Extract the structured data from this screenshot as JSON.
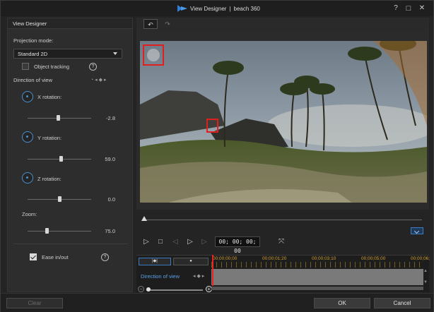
{
  "window": {
    "app_title": "View Designer",
    "separator": "|",
    "project_name": "beach 360",
    "help": "?",
    "restore": "□",
    "close": "✕"
  },
  "left_panel": {
    "header": "View Designer",
    "projection_mode_label": "Projection mode:",
    "projection_mode_value": "Standard 2D",
    "object_tracking_label": "Object tracking",
    "object_tracking_checked": false,
    "direction_of_view_label": "Direction of view",
    "x_rotation_label": "X rotation:",
    "x_rotation_value": "-2.8",
    "y_rotation_label": "Y rotation:",
    "y_rotation_value": "59.0",
    "z_rotation_label": "Z rotation:",
    "z_rotation_value": "0.0",
    "zoom_label": "Zoom:",
    "zoom_value": "75.0",
    "ease_label": "Ease in/out",
    "ease_checked": true
  },
  "toolbar": {
    "undo": "↶",
    "redo": "↷"
  },
  "player": {
    "timecode": "00; 00; 00; 00"
  },
  "timeline": {
    "tab_keyframe": "|◆|",
    "tab_nav": "●",
    "ticks": [
      "00;00;00;00",
      "00;00;01;20",
      "00;00;03;10",
      "00;00;05;00",
      "00;00;06;"
    ],
    "track_label": "Direction of view"
  },
  "footer": {
    "clear_label": "Clear",
    "ok_label": "OK",
    "cancel_label": "Cancel"
  }
}
